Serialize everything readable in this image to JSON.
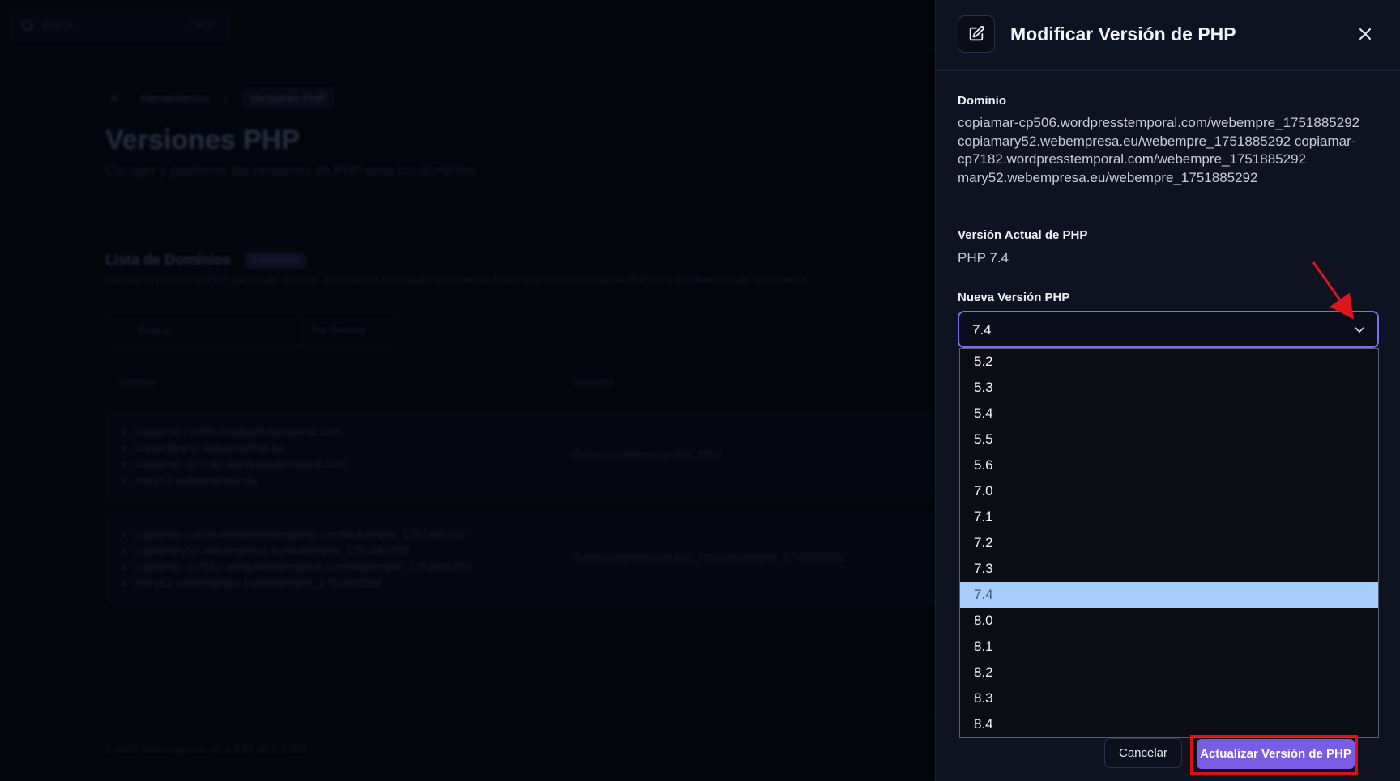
{
  "background": {
    "search_placeholder": "Buscar...",
    "search_shortcut": "Ctrl K",
    "breadcrumb": [
      "Herramientas",
      "Versiones PHP"
    ],
    "page_title": "Versiones PHP",
    "page_subtitle": "Escoger y gestionar las versiones de PHP para tus dominios.",
    "list_title": "Lista de Dominios",
    "list_badge": "3 elementos",
    "list_description": "Cambia la versión de PHP para cada dominio. La columna 'Heredado del Sistema' indica si la versión actual de PHP es la predeterminada del sistema.",
    "filter_search_placeholder": "Buscar...",
    "filter_select": "Por Dominio",
    "columns": [
      "Dominio",
      "Directorio"
    ],
    "rows": [
      {
        "domains": [
          "copiamar-cp506.wordpresstemporal.com",
          "copiamary52.webempresa.eu",
          "copiamar-cp7182.wordpresstemporal.com",
          "mary52.webempresa.eu"
        ],
        "directory": "/home2/copiamar/public_html"
      },
      {
        "domains": [
          "copiamar-cp506.wordpresstemporal.com/webempre_1751885292",
          "copiamary52.webempresa.eu/webempre_1751885292",
          "copiamar-cp7182.wordpresstemporal.com/webempre_1751885292",
          "mary52.webempresa.eu/webempre_1751885292"
        ],
        "directory": "/home2/copiamar/public_html/webempre_1751885292"
      }
    ],
    "footer": "© 2025 Webempresa. v1.4.0.62 vb.3.0.330"
  },
  "panel": {
    "title": "Modificar Versión de PHP",
    "domain_label": "Dominio",
    "domain_value": "copiamar-cp506.wordpresstemporal.com/webempre_1751885292 copiamary52.webempresa.eu/webempre_1751885292 copiamar-cp7182.wordpresstemporal.com/webempre_1751885292 mary52.webempresa.eu/webempre_1751885292",
    "current_label": "Versión Actual de PHP",
    "current_value": "PHP 7.4",
    "new_label": "Nueva Versión PHP",
    "selected_version": "7.4",
    "options": [
      "5.2",
      "5.3",
      "5.4",
      "5.5",
      "5.6",
      "7.0",
      "7.1",
      "7.2",
      "7.3",
      "7.4",
      "8.0",
      "8.1",
      "8.2",
      "8.3",
      "8.4"
    ],
    "cancel_label": "Cancelar",
    "submit_label": "Actualizar Versión de PHP"
  },
  "colors": {
    "accent": "#7a5be3",
    "highlight_frame": "#e10f12",
    "selected_option": "#a7cdfd",
    "annotation_arrow": "#e0151b"
  }
}
